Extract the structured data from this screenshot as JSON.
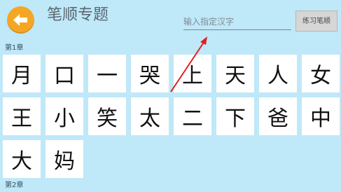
{
  "header": {
    "title": "笔顺专题",
    "search_placeholder": "输入指定汉字",
    "practice_button_label": "练习笔顺"
  },
  "chapters": [
    {
      "label": "第1章",
      "characters": [
        "月",
        "口",
        "一",
        "哭",
        "上",
        "天",
        "人",
        "女",
        "王",
        "小",
        "笑",
        "太",
        "二",
        "下",
        "爸",
        "中",
        "大",
        "妈"
      ]
    },
    {
      "label": "第2章",
      "characters": []
    }
  ],
  "colors": {
    "background": "#bfe8f8",
    "back_button": "#f5a623",
    "card": "#ffffff",
    "annotation_arrow": "#e02020"
  },
  "icons": {
    "back": "left-arrow-icon"
  }
}
